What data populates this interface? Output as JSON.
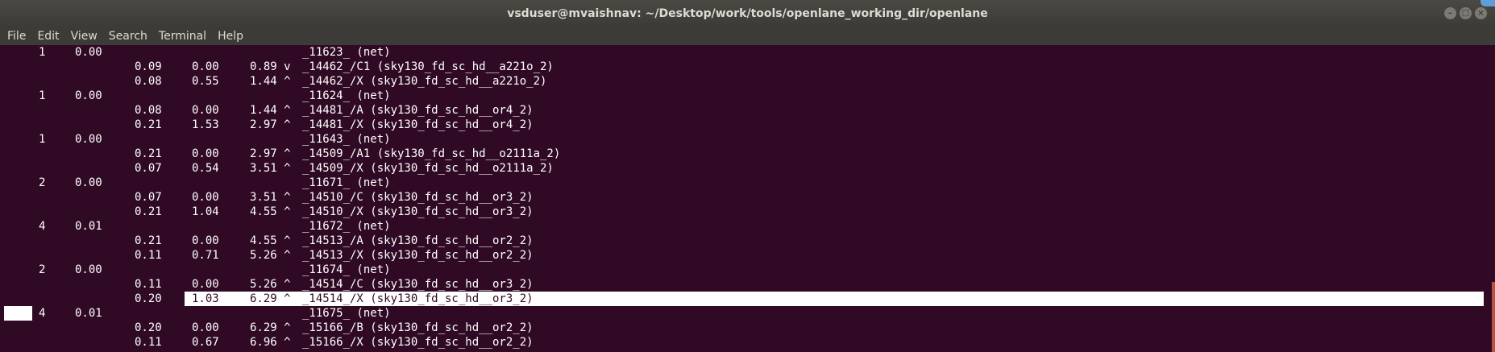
{
  "window": {
    "title": "vsduser@mvaishnav: ~/Desktop/work/tools/openlane_working_dir/openlane"
  },
  "menu": [
    "File",
    "Edit",
    "View",
    "Search",
    "Terminal",
    "Help"
  ],
  "terminal": {
    "lines": [
      {
        "fanout": "1",
        "cap": "0.00",
        "slew": "",
        "delay": "",
        "time": "",
        "desc": "_11623_ (net)"
      },
      {
        "fanout": "",
        "cap": "",
        "slew": "0.09",
        "delay": "0.00",
        "time": "0.89 v",
        "desc": "_14462_/C1 (sky130_fd_sc_hd__a221o_2)"
      },
      {
        "fanout": "",
        "cap": "",
        "slew": "0.08",
        "delay": "0.55",
        "time": "1.44 ^",
        "desc": "_14462_/X (sky130_fd_sc_hd__a221o_2)"
      },
      {
        "fanout": "1",
        "cap": "0.00",
        "slew": "",
        "delay": "",
        "time": "",
        "desc": "_11624_ (net)"
      },
      {
        "fanout": "",
        "cap": "",
        "slew": "0.08",
        "delay": "0.00",
        "time": "1.44 ^",
        "desc": "_14481_/A (sky130_fd_sc_hd__or4_2)"
      },
      {
        "fanout": "",
        "cap": "",
        "slew": "0.21",
        "delay": "1.53",
        "time": "2.97 ^",
        "desc": "_14481_/X (sky130_fd_sc_hd__or4_2)"
      },
      {
        "fanout": "1",
        "cap": "0.00",
        "slew": "",
        "delay": "",
        "time": "",
        "desc": "_11643_ (net)"
      },
      {
        "fanout": "",
        "cap": "",
        "slew": "0.21",
        "delay": "0.00",
        "time": "2.97 ^",
        "desc": "_14509_/A1 (sky130_fd_sc_hd__o2111a_2)"
      },
      {
        "fanout": "",
        "cap": "",
        "slew": "0.07",
        "delay": "0.54",
        "time": "3.51 ^",
        "desc": "_14509_/X (sky130_fd_sc_hd__o2111a_2)"
      },
      {
        "fanout": "2",
        "cap": "0.00",
        "slew": "",
        "delay": "",
        "time": "",
        "desc": "_11671_ (net)"
      },
      {
        "fanout": "",
        "cap": "",
        "slew": "0.07",
        "delay": "0.00",
        "time": "3.51 ^",
        "desc": "_14510_/C (sky130_fd_sc_hd__or3_2)"
      },
      {
        "fanout": "",
        "cap": "",
        "slew": "0.21",
        "delay": "1.04",
        "time": "4.55 ^",
        "desc": "_14510_/X (sky130_fd_sc_hd__or3_2)"
      },
      {
        "fanout": "4",
        "cap": "0.01",
        "slew": "",
        "delay": "",
        "time": "",
        "desc": "_11672_ (net)"
      },
      {
        "fanout": "",
        "cap": "",
        "slew": "0.21",
        "delay": "0.00",
        "time": "4.55 ^",
        "desc": "_14513_/A (sky130_fd_sc_hd__or2_2)"
      },
      {
        "fanout": "",
        "cap": "",
        "slew": "0.11",
        "delay": "0.71",
        "time": "5.26 ^",
        "desc": "_14513_/X (sky130_fd_sc_hd__or2_2)"
      },
      {
        "fanout": "2",
        "cap": "0.00",
        "slew": "",
        "delay": "",
        "time": "",
        "desc": "_11674_ (net)"
      },
      {
        "fanout": "",
        "cap": "",
        "slew": "0.11",
        "delay": "0.00",
        "time": "5.26 ^",
        "desc": "_14514_/C (sky130_fd_sc_hd__or3_2)"
      },
      {
        "fanout": "",
        "cap": "",
        "slew": "0.20",
        "delay": "1.03",
        "time": "6.29 ^",
        "desc": "_14514_/X (sky130_fd_sc_hd__or3_2)",
        "highlight": true
      },
      {
        "fanout": "4",
        "cap": "0.01",
        "slew": "",
        "delay": "",
        "time": "",
        "desc": "_11675_ (net)",
        "cursor": true
      },
      {
        "fanout": "",
        "cap": "",
        "slew": "0.20",
        "delay": "0.00",
        "time": "6.29 ^",
        "desc": "_15166_/B (sky130_fd_sc_hd__or2_2)"
      },
      {
        "fanout": "",
        "cap": "",
        "slew": "0.11",
        "delay": "0.67",
        "time": "6.96 ^",
        "desc": "_15166_/X (sky130_fd_sc_hd__or2_2)"
      }
    ]
  },
  "colors": {
    "background": "#300a24",
    "text": "#ffffff",
    "titlebar": "#3c3b37"
  }
}
